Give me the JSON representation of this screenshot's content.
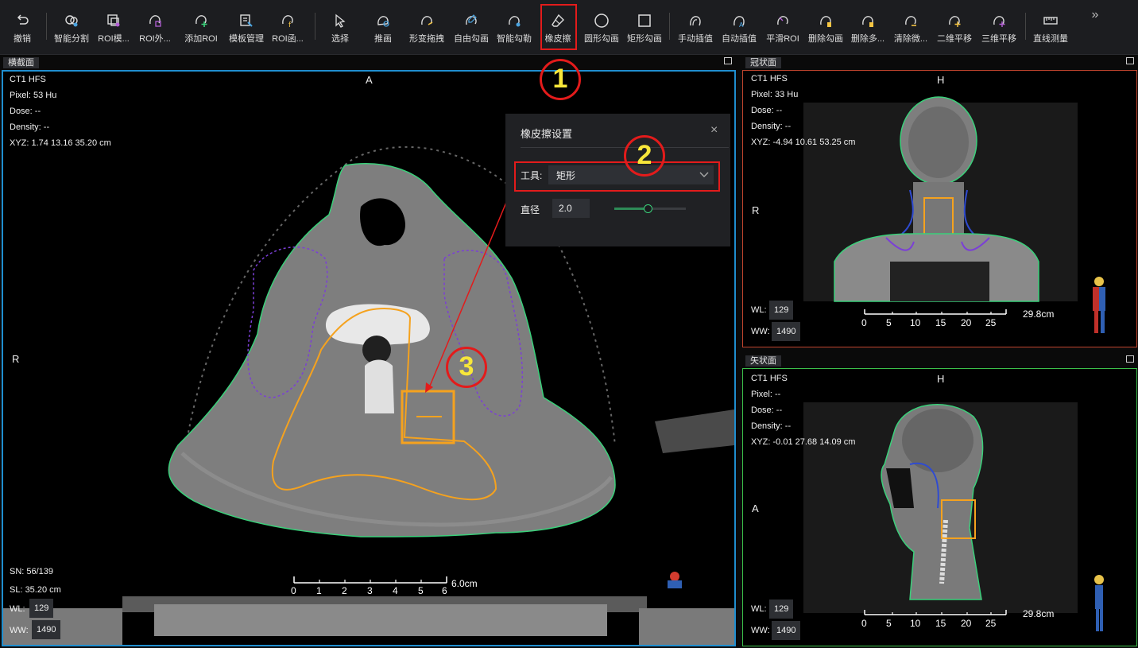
{
  "toolbar": {
    "items": [
      {
        "label": "撤销",
        "icon": "undo-icon"
      },
      {
        "label": "智能分割",
        "icon": "smart-segment-icon"
      },
      {
        "label": "ROI模...",
        "icon": "roi-template-icon"
      },
      {
        "label": "ROI外...",
        "icon": "roi-expand-icon"
      },
      {
        "label": "添加ROI",
        "icon": "add-roi-icon"
      },
      {
        "label": "模板管理",
        "icon": "template-manage-icon"
      },
      {
        "label": "ROI函...",
        "icon": "roi-function-icon"
      },
      {
        "label": "选择",
        "icon": "select-arrow-icon"
      },
      {
        "label": "推画",
        "icon": "push-draw-icon"
      },
      {
        "label": "形变拖拽",
        "icon": "deform-drag-icon"
      },
      {
        "label": "自由勾画",
        "icon": "freehand-icon"
      },
      {
        "label": "智能勾勒",
        "icon": "smart-outline-icon"
      },
      {
        "label": "橡皮擦",
        "icon": "eraser-icon"
      },
      {
        "label": "圆形勾画",
        "icon": "circle-draw-icon"
      },
      {
        "label": "矩形勾画",
        "icon": "rect-draw-icon"
      },
      {
        "label": "手动插值",
        "icon": "manual-interp-icon"
      },
      {
        "label": "自动插值",
        "icon": "auto-interp-icon"
      },
      {
        "label": "平滑ROI",
        "icon": "smooth-roi-icon"
      },
      {
        "label": "删除勾画",
        "icon": "delete-contour-icon"
      },
      {
        "label": "删除多...",
        "icon": "delete-multi-icon"
      },
      {
        "label": "清除微...",
        "icon": "clear-micro-icon"
      },
      {
        "label": "二维平移",
        "icon": "pan-2d-icon"
      },
      {
        "label": "三维平移",
        "icon": "pan-3d-icon"
      },
      {
        "label": "直线测量",
        "icon": "ruler-icon"
      }
    ],
    "more": "»"
  },
  "axial": {
    "title": "横截面",
    "info": [
      "CT1 HFS",
      "Pixel:  53 Hu",
      "Dose:  --",
      "Density:  --",
      "XYZ: 1.74 13.16 35.20 cm"
    ],
    "dir_top": "A",
    "dir_left": "R",
    "sn": "SN: 56/139",
    "sl": "SL: 35.20 cm",
    "wl_label": "WL:",
    "wl": "129",
    "ww_label": "WW:",
    "ww": "1490",
    "scale_ticks": [
      "0",
      "1",
      "2",
      "3",
      "4",
      "5",
      "6"
    ],
    "scale_unit": "6.0cm"
  },
  "coronal": {
    "title": "冠状面",
    "info": [
      "CT1 HFS",
      "Pixel:  33 Hu",
      "Dose:  --",
      "Density:  --",
      "XYZ: -4.94 10.61 53.25 cm"
    ],
    "dir_top": "H",
    "dir_left": "R",
    "wl_label": "WL:",
    "wl": "129",
    "ww_label": "WW:",
    "ww": "1490",
    "scale_ticks": [
      "0",
      "5",
      "10",
      "15",
      "20",
      "25"
    ],
    "scale_unit": "29.8cm"
  },
  "sagittal": {
    "title": "矢状面",
    "info": [
      "CT1 HFS",
      "Pixel:  --",
      "Dose:  --",
      "Density:  --",
      "XYZ: -0.01 27.68 14.09 cm"
    ],
    "dir_top": "H",
    "dir_left": "A",
    "wl_label": "WL:",
    "wl": "129",
    "ww_label": "WW:",
    "ww": "1490",
    "scale_ticks": [
      "0",
      "5",
      "10",
      "15",
      "20",
      "25"
    ],
    "scale_unit": "29.8cm"
  },
  "eraser_popup": {
    "title": "橡皮擦设置",
    "close": "×",
    "tool_label": "工具:",
    "tool_value": "矩形",
    "diameter_label": "直径",
    "diameter_value": "2.0",
    "slider_fraction": 0.47
  },
  "callouts": [
    "1",
    "2",
    "3"
  ],
  "colors": {
    "accent_axial": "#1f8ecf",
    "accent_coronal": "#c0442d",
    "accent_sagittal": "#3bbf4a",
    "contour_body": "#3ad07a",
    "contour_orange": "#f5a21e",
    "contour_purple": "#7b3fd6",
    "highlight_red": "#e31b1b",
    "callout_yellow": "#f7e63a"
  }
}
